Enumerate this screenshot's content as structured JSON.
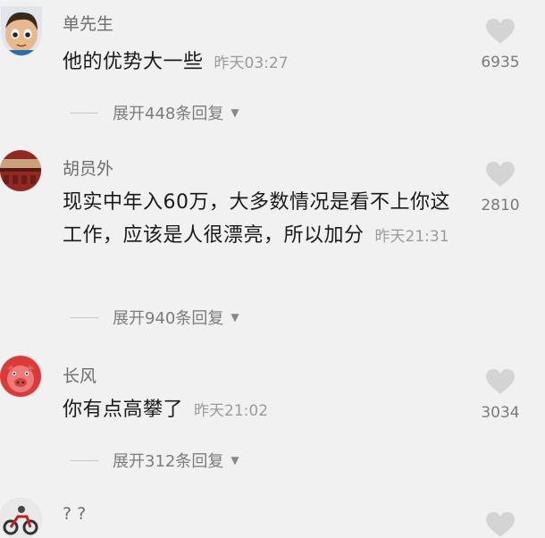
{
  "comments": [
    {
      "username": "单先生",
      "text": "他的优势大一些",
      "time": "昨天03:27",
      "likes": "6935",
      "expand": "展开448条回复",
      "avatar_icon": "cartoon-boy-avatar"
    },
    {
      "username": "胡员外",
      "text": "现实中年入60万，大多数情况是看不上你这工作，应该是人很漂亮，所以加分",
      "time": "昨天21:31",
      "likes": "2810",
      "expand": "展开940条回复",
      "avatar_icon": "red-building-avatar"
    },
    {
      "username": "长风",
      "text": "你有点高攀了",
      "time": "昨天21:02",
      "likes": "3034",
      "expand": "展开312条回复",
      "avatar_icon": "red-pig-avatar"
    },
    {
      "username": "? ?",
      "avatar_icon": "motorcycle-avatar"
    }
  ],
  "colors": {
    "background": "#f1f1f1",
    "like_icon": "#d4d4d4",
    "username": "#6d6d6d",
    "time": "#9a9a9a"
  }
}
